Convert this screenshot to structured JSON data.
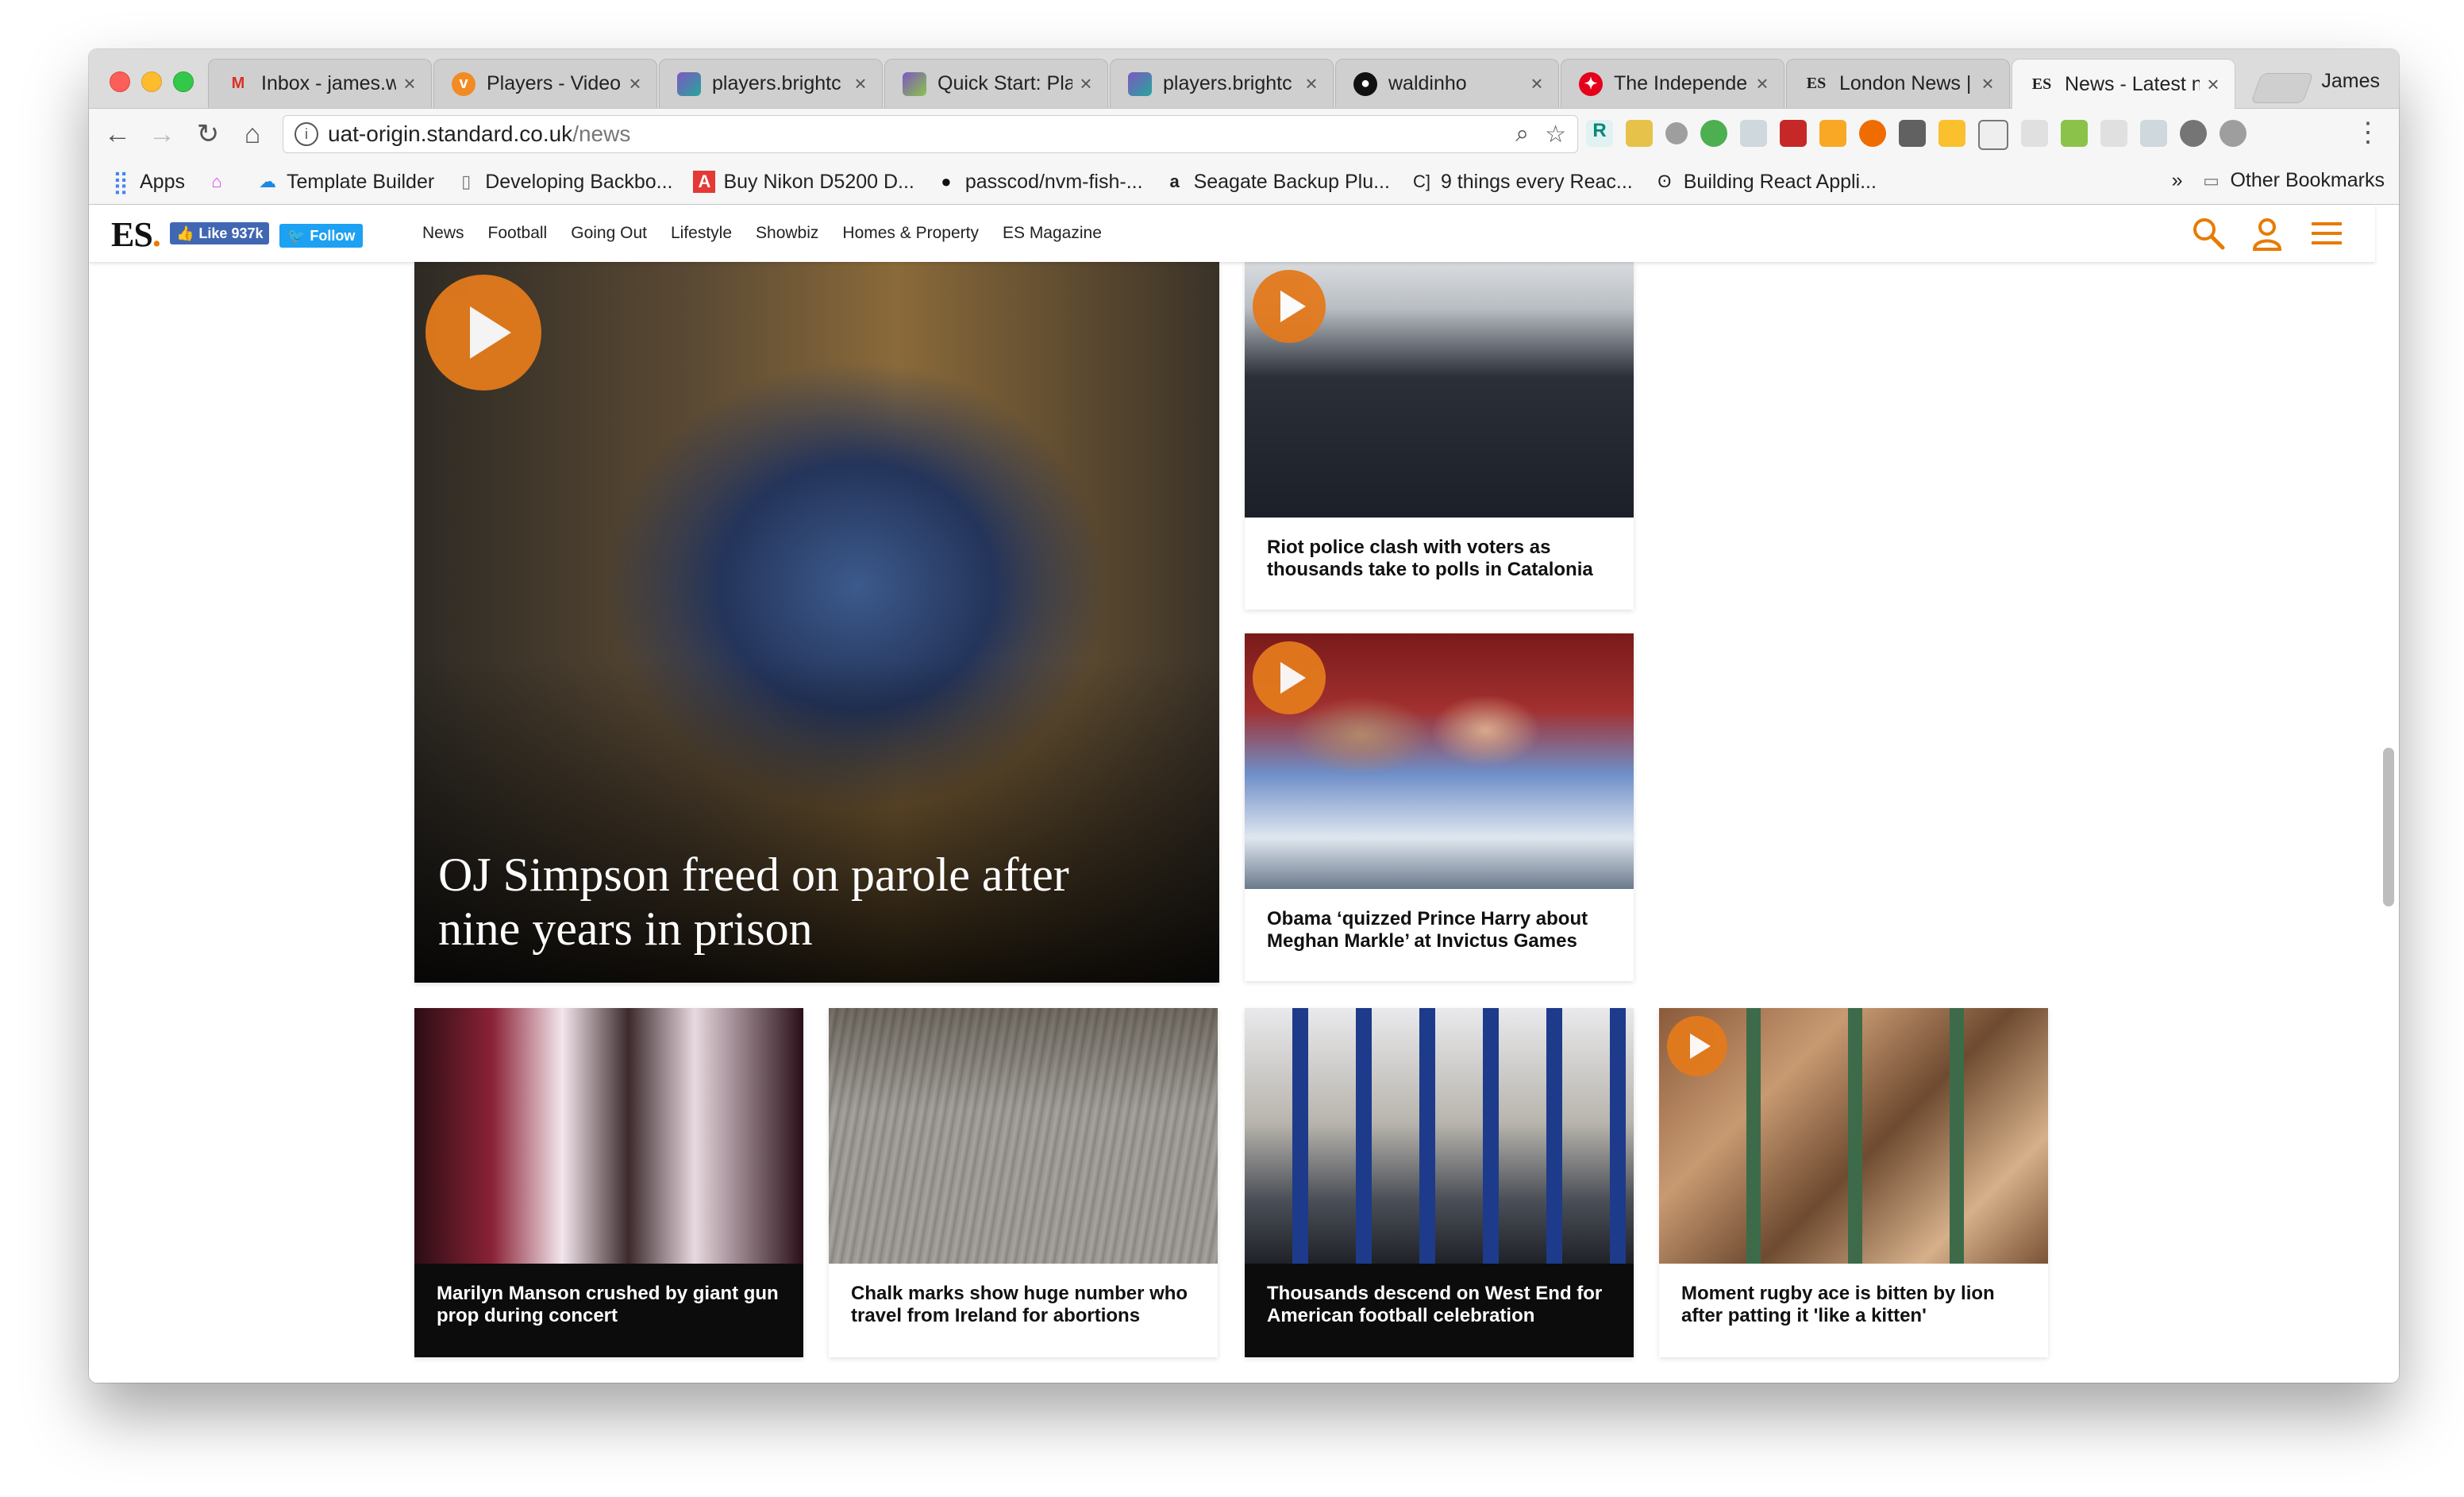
{
  "browser": {
    "tabs": [
      {
        "title": "Inbox - james.w",
        "icon": "gmail-icon",
        "color": "#d93025"
      },
      {
        "title": "Players - Video",
        "icon": "brightcove-icon",
        "color": "#f28b22"
      },
      {
        "title": "players.brightc",
        "icon": "cube-icon",
        "color": "#7e57c2"
      },
      {
        "title": "Quick Start: Pla",
        "icon": "cube-icon",
        "color": "#7e57c2"
      },
      {
        "title": "players.brightc",
        "icon": "cube-icon",
        "color": "#7e57c2"
      },
      {
        "title": "waldinho",
        "icon": "github-icon",
        "color": "#111111"
      },
      {
        "title": "The Independe",
        "icon": "independent-icon",
        "color": "#e5001c"
      },
      {
        "title": "London News |",
        "icon": "es-icon",
        "color": "#111111"
      },
      {
        "title": "News - Latest n",
        "icon": "es-icon",
        "color": "#111111",
        "active": true
      }
    ],
    "profile_name": "James",
    "url_host": "uat-origin.standard.co.uk",
    "url_path": "/news",
    "bookmarks": [
      {
        "label": "Apps",
        "icon": "apps-grid-icon"
      },
      {
        "label": "",
        "icon": "house-icon"
      },
      {
        "label": "Template Builder",
        "icon": "cloud-icon"
      },
      {
        "label": "Developing Backbo...",
        "icon": "page-icon"
      },
      {
        "label": "Buy Nikon D5200 D...",
        "icon": "adobe-icon"
      },
      {
        "label": "passcod/nvm-fish-...",
        "icon": "github-icon"
      },
      {
        "label": "Seagate Backup Plu...",
        "icon": "amazon-icon"
      },
      {
        "label": "9 things every Reac...",
        "icon": "bracket-icon"
      },
      {
        "label": "Building React Appli...",
        "icon": "glasses-icon"
      }
    ],
    "bookmarks_overflow": "»",
    "other_bookmarks": "Other Bookmarks"
  },
  "site": {
    "logo": "ES",
    "fb_like": "Like 937k",
    "tw_follow": "Follow",
    "nav": [
      "News",
      "Football",
      "Going Out",
      "Lifestyle",
      "Showbiz",
      "Homes & Property",
      "ES Magazine"
    ],
    "accent": "#e77b00"
  },
  "articles": {
    "hero": {
      "title": "OJ Simpson freed on parole after nine years in prison",
      "video": true
    },
    "side": [
      {
        "title": "Riot police clash with voters as thousands take to polls in Catalonia",
        "video": true
      },
      {
        "title": "Obama ‘quizzed Prince Harry about Meghan Markle’ at Invictus Games",
        "video": true
      }
    ],
    "row": [
      {
        "title": "Marilyn Manson crushed by giant gun prop during concert",
        "video": false,
        "dark": true
      },
      {
        "title": "Chalk marks show huge number who travel from Ireland for abortions",
        "video": false,
        "dark": false
      },
      {
        "title": "Thousands descend on West End for American football celebration",
        "video": false,
        "dark": true
      },
      {
        "title": "Moment rugby ace is bitten by lion after patting it 'like a kitten'",
        "video": true,
        "dark": false
      }
    ]
  }
}
